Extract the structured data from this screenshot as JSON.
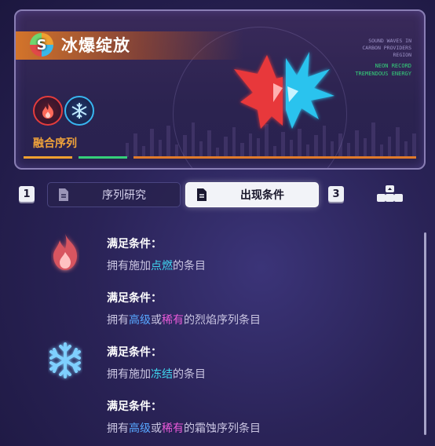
{
  "card": {
    "title": "冰爆绽放",
    "fusion_label": "融合序列",
    "side_text_lines": [
      "SOUND WAVES IN",
      "CARBON PROVIDERS",
      "REGION"
    ],
    "side_green_lines": [
      "NEON RECORD",
      "TREMENDOUS ENERGY"
    ],
    "progress": [
      0.125,
      0.125,
      0.72
    ]
  },
  "tabs": {
    "key_left": "1",
    "research_label": "序列研究",
    "conditions_label": "出现条件",
    "key_right": "3"
  },
  "conditions": [
    {
      "icon": "fire-icon",
      "heading": "满足条件：",
      "pre": "拥有施加",
      "hl1": "点燃",
      "hl1_color": "cyan",
      "mid": "",
      "hl2": "",
      "post": "的条目"
    },
    {
      "icon": "",
      "heading": "满足条件：",
      "pre": "拥有",
      "hl1": "高级",
      "hl1_color": "blue",
      "mid": "或",
      "hl2": "稀有",
      "post": "的烈焰序列条目"
    },
    {
      "icon": "snowflake-icon",
      "heading": "满足条件：",
      "pre": "拥有施加",
      "hl1": "冻结",
      "hl1_color": "cyan",
      "mid": "",
      "hl2": "",
      "post": "的条目"
    },
    {
      "icon": "",
      "heading": "满足条件：",
      "pre": "拥有",
      "hl1": "高级",
      "hl1_color": "blue",
      "mid": "或",
      "hl2": "稀有",
      "post": "的霜蚀序列条目"
    }
  ],
  "colors": {
    "accent_orange": "#f0a030",
    "fire_red": "#e43c3c",
    "ice_blue": "#38b6f0",
    "rare_pink": "#e85ad8",
    "advanced_blue": "#57a6ff"
  }
}
